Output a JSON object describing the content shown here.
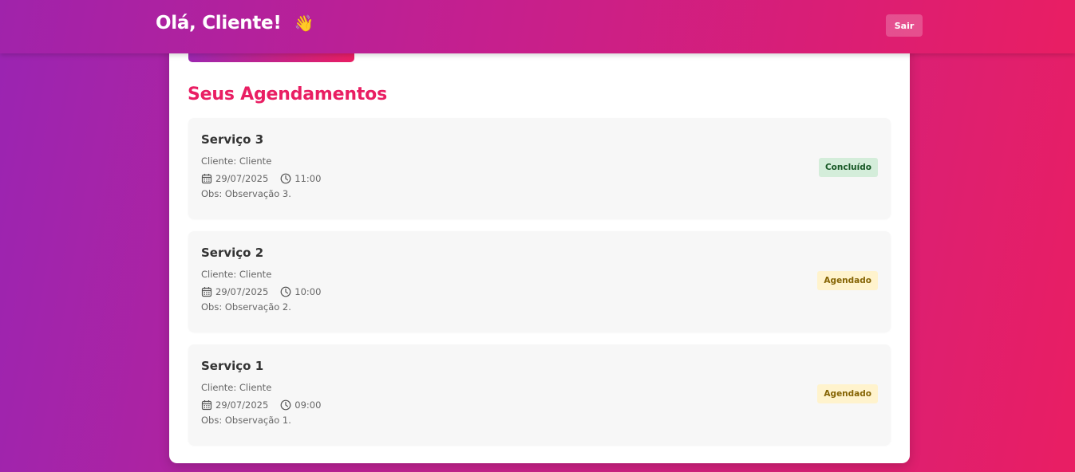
{
  "header": {
    "greeting": "Olá, Cliente!",
    "wave_emoji": "👋",
    "logout_label": "Sair"
  },
  "section_title": "Seus Agendamentos",
  "appointments": [
    {
      "service": "Serviço 3",
      "client": "Cliente: Cliente",
      "date": "29/07/2025",
      "time": "11:00",
      "obs": "Obs: Observação 3.",
      "status": "Concluído",
      "status_color": "#d4edda"
    },
    {
      "service": "Serviço 2",
      "client": "Cliente: Cliente",
      "date": "29/07/2025",
      "time": "10:00",
      "obs": "Obs: Observação 2.",
      "status": "Agendado",
      "status_color": "#fff3cd"
    },
    {
      "service": "Serviço 1",
      "client": "Cliente: Cliente",
      "date": "29/07/2025",
      "time": "09:00",
      "obs": "Obs: Observação 1.",
      "status": "Agendado",
      "status_color": "#fff3cd"
    }
  ],
  "icons": {
    "calendar": "calendar-icon",
    "clock": "clock-icon"
  },
  "colors": {
    "accent": "#e91e63",
    "gradient_start": "#9c27b0",
    "gradient_end": "#e91e63"
  }
}
